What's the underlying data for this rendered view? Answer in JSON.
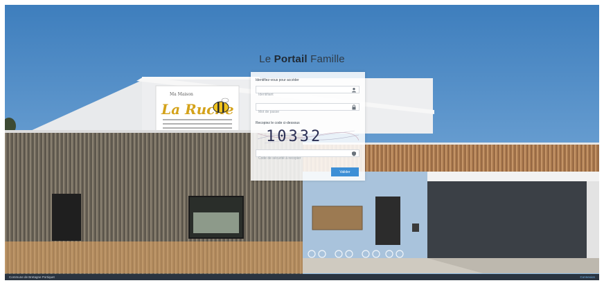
{
  "portal": {
    "title_prefix": "Le",
    "title_bold": "Portail",
    "title_suffix": "Famille"
  },
  "sign": {
    "small_text": "Ma Maison",
    "name": "La Ruche"
  },
  "login": {
    "heading": "Identifiez-vous pour accéder",
    "identifier_placeholder": "Identifiant",
    "password_placeholder": "Mot de passe",
    "captcha_label": "Recopiez le code ci-dessous",
    "captcha_code": "10332",
    "captcha_input_placeholder": "Code de sécurité à recopier",
    "submit_label": "Valider"
  },
  "footer": {
    "left_text": "Commune de Bretagne Portiquet",
    "right_text": "Connexion"
  },
  "colors": {
    "accent": "#3d8fd6",
    "footer_bg": "#2a3440"
  }
}
